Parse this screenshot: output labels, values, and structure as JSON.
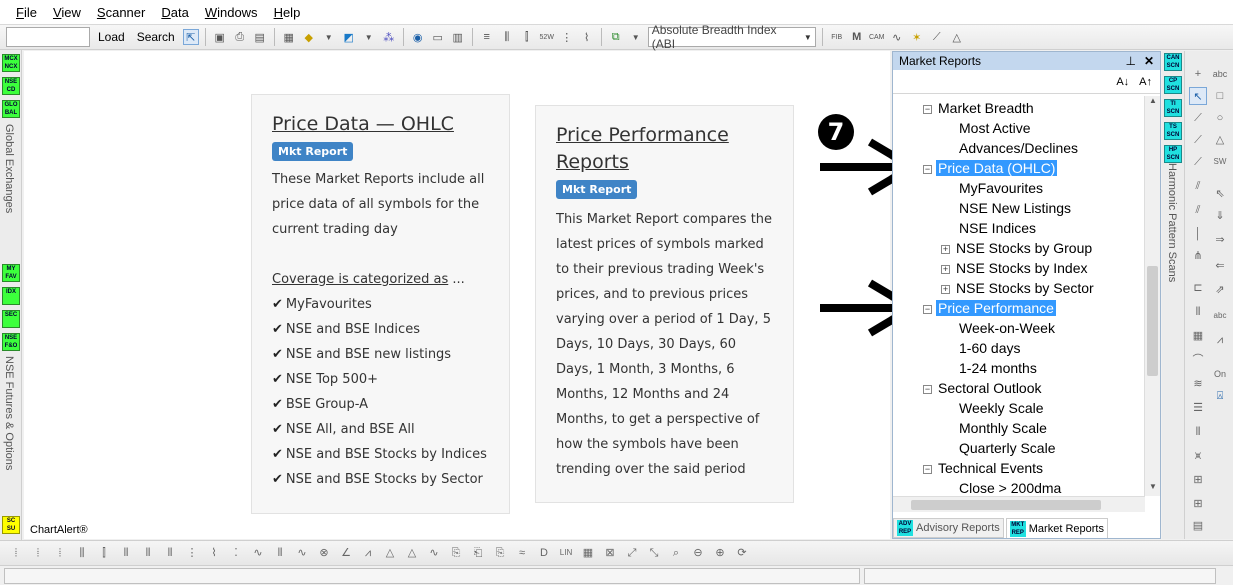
{
  "menubar": {
    "items": [
      {
        "label": "File",
        "ul": "F",
        "rest": "ile"
      },
      {
        "label": "View",
        "ul": "V",
        "rest": "iew"
      },
      {
        "label": "Scanner",
        "ul": "S",
        "rest": "canner"
      },
      {
        "label": "Data",
        "ul": "D",
        "rest": "ata"
      },
      {
        "label": "Windows",
        "ul": "W",
        "rest": "indows"
      },
      {
        "label": "Help",
        "ul": "H",
        "rest": "elp"
      }
    ]
  },
  "toolbar": {
    "symbol_value": "",
    "load_label": "Load",
    "search_label": "Search",
    "indicator_select": "Absolute Breadth Index (ABI"
  },
  "left_strip": {
    "top_buttons": [
      "MCX NCX",
      "NSE CD",
      "GLO BAL"
    ],
    "global_label": "Global Exchanges",
    "mid_buttons": [
      "MY FAV",
      "IDX",
      "SEC",
      "NSE F&O"
    ],
    "fno_label": "NSE Futures & Options",
    "bottom_button": "SC SU"
  },
  "main": {
    "card1": {
      "title": "Price Data — OHLC",
      "badge": "Mkt Report",
      "description": "These Market Reports include all price data of all symbols for the current trading day",
      "coverage_label": "Coverage is categorized as",
      "coverage_suffix": " ...",
      "items": [
        "MyFavourites",
        "NSE and BSE Indices",
        "NSE and BSE new listings",
        "NSE Top 500+",
        "BSE Group-A",
        "NSE All, and BSE All",
        "NSE and BSE Stocks by Indices",
        "NSE and BSE Stocks by Sector"
      ]
    },
    "card2": {
      "title": "Price Performance Reports",
      "badge": "Mkt Report",
      "description": "This Market Report compares the latest prices of symbols marked to their previous trading Week's prices, and to previous prices varying over a period of 1 Day, 5 Days, 10 Days, 30 Days, 60 Days, 1 Month, 3 Months, 6 Months, 12 Months and 24 Months, to get a perspective of how the symbols have been trending over the said period"
    },
    "footer": "ChartAlert®",
    "marker": "7"
  },
  "panel": {
    "title": "Market Reports",
    "pin_icon": "pin-icon",
    "close_icon": "close-icon",
    "sort_asc": "A↓",
    "sort_desc": "A↑",
    "tree": [
      {
        "label": "Market Breadth",
        "level": 1,
        "toggle": "−",
        "selected": false
      },
      {
        "label": "Most Active",
        "level": 2,
        "toggle": "",
        "selected": false
      },
      {
        "label": "Advances/Declines",
        "level": 2,
        "toggle": "",
        "selected": false
      },
      {
        "label": "Price Data (OHLC)",
        "level": 1,
        "toggle": "−",
        "selected": true
      },
      {
        "label": "MyFavourites",
        "level": 2,
        "toggle": "",
        "selected": false
      },
      {
        "label": "NSE New Listings",
        "level": 2,
        "toggle": "",
        "selected": false
      },
      {
        "label": "NSE Indices",
        "level": 2,
        "toggle": "",
        "selected": false
      },
      {
        "label": "NSE Stocks by Group",
        "level": 2,
        "toggle": "+",
        "selected": false
      },
      {
        "label": "NSE Stocks by Index",
        "level": 2,
        "toggle": "+",
        "selected": false
      },
      {
        "label": "NSE Stocks by Sector",
        "level": 2,
        "toggle": "+",
        "selected": false
      },
      {
        "label": "Price Performance",
        "level": 1,
        "toggle": "−",
        "selected": true
      },
      {
        "label": "Week-on-Week",
        "level": 2,
        "toggle": "",
        "selected": false
      },
      {
        "label": "1-60 days",
        "level": 2,
        "toggle": "",
        "selected": false
      },
      {
        "label": "1-24 months",
        "level": 2,
        "toggle": "",
        "selected": false
      },
      {
        "label": "Sectoral Outlook",
        "level": 1,
        "toggle": "−",
        "selected": false
      },
      {
        "label": "Weekly Scale",
        "level": 2,
        "toggle": "",
        "selected": false
      },
      {
        "label": "Monthly Scale",
        "level": 2,
        "toggle": "",
        "selected": false
      },
      {
        "label": "Quarterly Scale",
        "level": 2,
        "toggle": "",
        "selected": false
      },
      {
        "label": "Technical Events",
        "level": 1,
        "toggle": "−",
        "selected": false
      },
      {
        "label": "Close > 200dma",
        "level": 2,
        "toggle": "",
        "selected": false
      }
    ],
    "tabs": [
      {
        "icon": "ADV REP",
        "label": "Advisory Reports",
        "active": false
      },
      {
        "icon": "MKT REP",
        "label": "Market Reports",
        "active": true
      }
    ]
  },
  "scan_strip": {
    "buttons": [
      "CAN SCN",
      "CP SCN",
      "TI SCN",
      "TS SCN",
      "HP SCN"
    ],
    "label": "Harmonic Pattern Scans"
  },
  "colors": {
    "selection": "#3399ff",
    "badge": "#3f84c6",
    "green_button": "#3cff3c",
    "cyan_button": "#20e0e0",
    "panel_header": "#c3d7ee"
  }
}
